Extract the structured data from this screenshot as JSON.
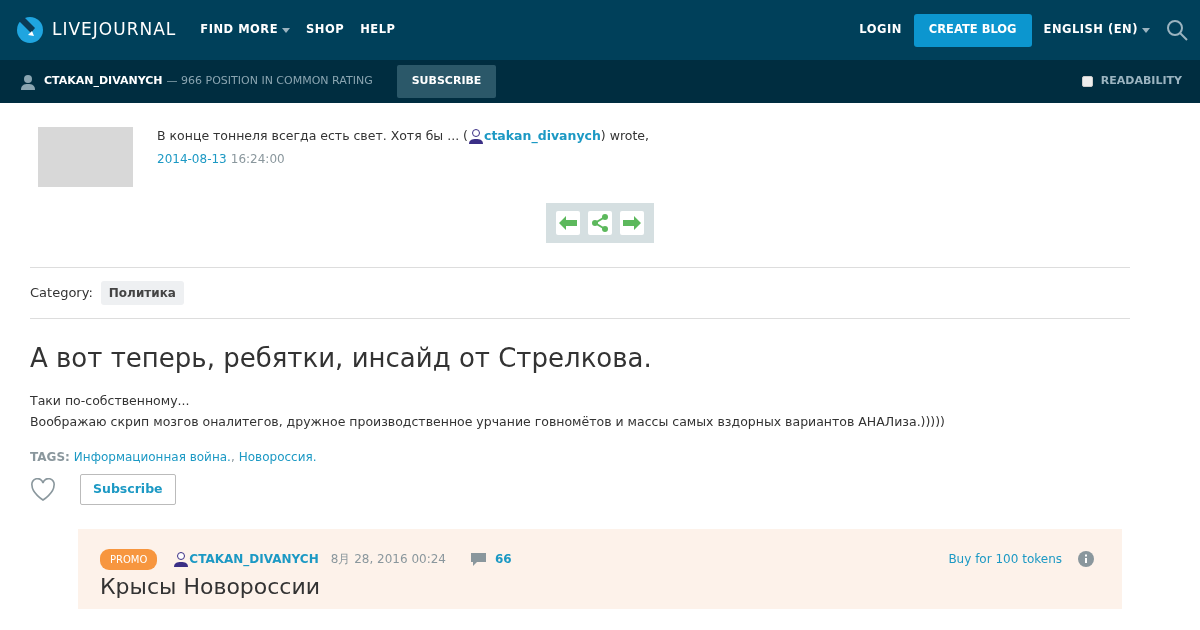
{
  "header": {
    "logo": "LIVEJOURNAL",
    "nav": [
      {
        "label": "FIND MORE",
        "dropdown": true
      },
      {
        "label": "SHOP",
        "dropdown": false
      },
      {
        "label": "HELP",
        "dropdown": false
      }
    ],
    "login": "LOGIN",
    "create": "CREATE BLOG",
    "language": "ENGLISH (EN)"
  },
  "subbar": {
    "user": "CTAKAN_DIVANYCH",
    "rating": "— 966 POSITION IN COMMON RATING",
    "subscribe": "SUBSCRIBE",
    "readability": {
      "label": "READABILITY",
      "checked": false
    }
  },
  "post": {
    "journal_title": "В конце тоннеля всегда есть свет. Хотя бы ... (",
    "author": "ctakan_divanych",
    "wrote": ") wrote,",
    "date": "2014-08-13",
    "time": "16:24:00",
    "category_label": "Category:",
    "category": "Политика",
    "title": "А вот теперь, ребятки, инсайд от Стрелкова.",
    "body": [
      "Таки по-собственному...",
      "Воображаю скрип мозгов оналитегов, дружное производственное урчание говномётов и массы самых вздорных вариантов АНАЛиза.)))))"
    ],
    "tags_label": "TAGS:",
    "tags": [
      "Информационная война.",
      "Новороссия."
    ],
    "tag_separator": ",",
    "subscribe": "Subscribe"
  },
  "promo": {
    "badge": "PROMO",
    "user": "CTAKAN_DIVANYCH",
    "date": "8月 28, 2016 00:24",
    "comments": "66",
    "buy": "Buy for 100 tokens",
    "title": "Крысы Новороссии"
  }
}
